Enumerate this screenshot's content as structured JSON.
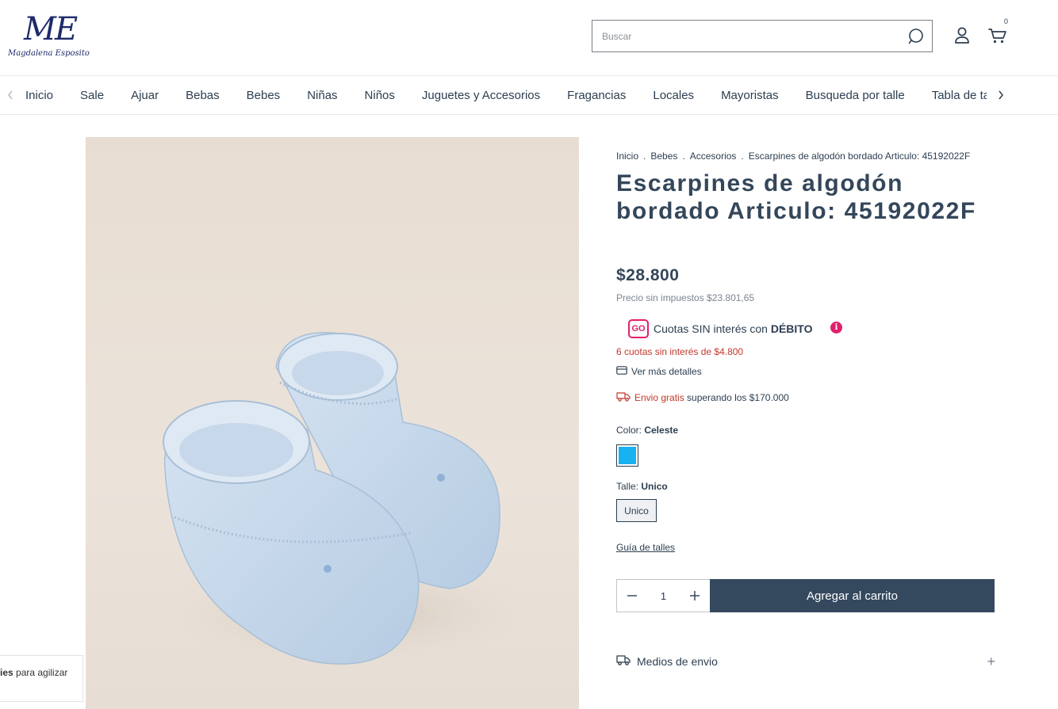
{
  "brand": {
    "logo_mark": "ME",
    "logo_text": "Magdalena Esposito"
  },
  "header": {
    "search_placeholder": "Buscar",
    "cart_count": "0"
  },
  "nav": {
    "items": [
      "Inicio",
      "Sale",
      "Ajuar",
      "Bebas",
      "Bebes",
      "Niñas",
      "Niños",
      "Juguetes y Accesorios",
      "Fragancias",
      "Locales",
      "Mayoristas",
      "Busqueda por talle",
      "Tabla de talles"
    ]
  },
  "breadcrumb": [
    "Inicio",
    "Bebes",
    "Accesorios",
    "Escarpines de algodón bordado Articulo: 45192022F"
  ],
  "product": {
    "title": "Escarpines de algodón bordado Articulo: 45192022F",
    "price": "$28.800",
    "price_notax": "Precio sin impuestos $23.801,65",
    "go_badge": "GO",
    "cuotas_prefix": "Cuotas SIN interés con ",
    "cuotas_bold": "DÉBITO",
    "cuotas_line": "6 cuotas sin interés de $4.800",
    "ver_mas": "Ver más detalles",
    "envio_red": "Envio gratis",
    "envio_rest": " superando los $170.000",
    "color_label": "Color: ",
    "color_value": "Celeste",
    "color_hex": "#18b2f0",
    "talle_label": "Talle: ",
    "talle_value": "Unico",
    "talle_option": "Unico",
    "guia": "Guía de talles",
    "quantity": "1",
    "add_to_cart": "Agregar al carrito",
    "medios": "Medios de envio"
  },
  "cookie": {
    "bold": "ies",
    "text": " para agilizar"
  },
  "colors": {
    "primary": "#34495e",
    "accent_pink": "#e0206c",
    "red": "#c0392b"
  }
}
